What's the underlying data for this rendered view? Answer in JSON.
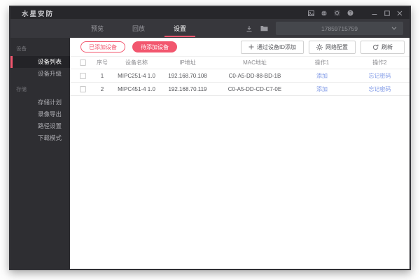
{
  "app": {
    "title": "水星安防"
  },
  "titlebar": {
    "icons": [
      "screenshot-icon",
      "globe-icon",
      "gear-icon",
      "help-icon"
    ],
    "controls": [
      "minimize",
      "maximize",
      "close"
    ]
  },
  "nav": {
    "tabs": [
      {
        "label": "预览",
        "active": false
      },
      {
        "label": "回放",
        "active": false
      },
      {
        "label": "设置",
        "active": true
      }
    ],
    "icons": [
      "download-icon",
      "folder-icon"
    ],
    "account": {
      "value": "17859715759"
    }
  },
  "sidebar": {
    "sections": [
      {
        "label": "设备",
        "items": [
          {
            "label": "设备列表",
            "active": true
          },
          {
            "label": "设备升级",
            "active": false
          }
        ]
      },
      {
        "label": "存储",
        "items": [
          {
            "label": "存储计划",
            "active": false
          },
          {
            "label": "录像导出",
            "active": false
          },
          {
            "label": "路径设置",
            "active": false
          },
          {
            "label": "下载模式",
            "active": false
          }
        ]
      }
    ]
  },
  "toolbar": {
    "added_filter": "已添加设备",
    "pending_filter": "待添加设备",
    "add_by_id": "通过设备ID添加",
    "network_config": "网络配置",
    "refresh": "刷新"
  },
  "table": {
    "headers": {
      "no": "序号",
      "name": "设备名称",
      "ip": "IP地址",
      "mac": "MAC地址",
      "op1": "操作1",
      "op2": "操作2"
    },
    "rows": [
      {
        "no": "1",
        "name": "MIPC251-4 1.0",
        "ip": "192.168.70.108",
        "mac": "C0-A5-DD-88-BD-1B",
        "op1": "添加",
        "op2": "忘记密码"
      },
      {
        "no": "2",
        "name": "MIPC451-4 1.0",
        "ip": "192.168.70.119",
        "mac": "C0-A5-DD-CD-C7-0E",
        "op1": "添加",
        "op2": "忘记密码"
      }
    ]
  },
  "colors": {
    "accent": "#f2566e",
    "link": "#7b96e6"
  }
}
